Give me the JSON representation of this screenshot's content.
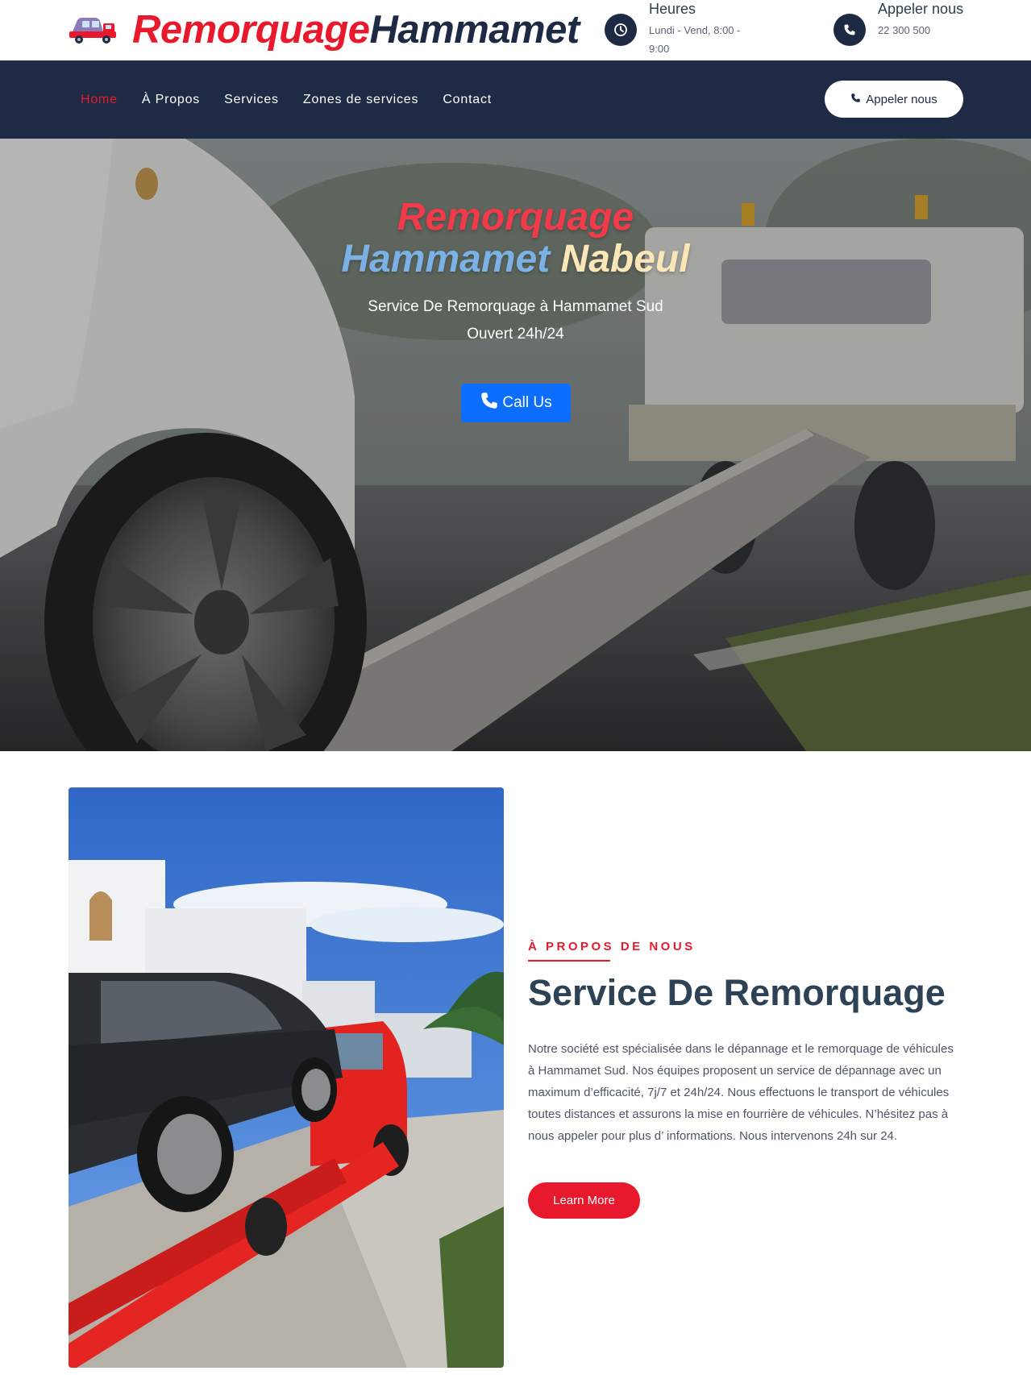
{
  "brand": {
    "part1": "Remorquage",
    "part2": "Hammamet",
    "colors": {
      "red": "#e8192c",
      "navy": "#1e2a44"
    }
  },
  "header": {
    "hours": {
      "title": "Heures",
      "value": "Lundi - Vend, 8:00 - 9:00",
      "icon": "clock-icon"
    },
    "call": {
      "title": "Appeler nous",
      "value": "22 300 500",
      "icon": "phone-icon"
    }
  },
  "nav": {
    "items": [
      {
        "label": "Home",
        "active": true
      },
      {
        "label": "À Propos",
        "active": false
      },
      {
        "label": "Services",
        "active": false
      },
      {
        "label": "Zones de services",
        "active": false
      },
      {
        "label": "Contact",
        "active": false
      }
    ],
    "cta": "Appeler nous"
  },
  "hero": {
    "title_line1": "Remorquage",
    "title_line2a": "Hammamet",
    "title_line2b": "Nabeul",
    "subtitle_line1": "Service De Remorquage à Hammamet Sud",
    "subtitle_line2": "Ouvert 24h/24",
    "button": "Call Us",
    "button_color": "#0d6efd"
  },
  "about": {
    "eyebrow": "À PROPOS DE NOUS",
    "title": "Service De Remorquage",
    "text": "Notre société est spécialisée dans le dépannage et le remorquage de véhicules à Hammamet Sud. Nos équipes proposent un service de dépannage avec un maximum d’efficacité, 7j/7 et 24h/24. Nous effectuons le transport de véhicules toutes distances et assurons la mise en fourrière de véhicules. N’hésitez pas à nous appeler pour plus d’ informations. Nous intervenons 24h sur 24.",
    "button": "Learn More"
  }
}
